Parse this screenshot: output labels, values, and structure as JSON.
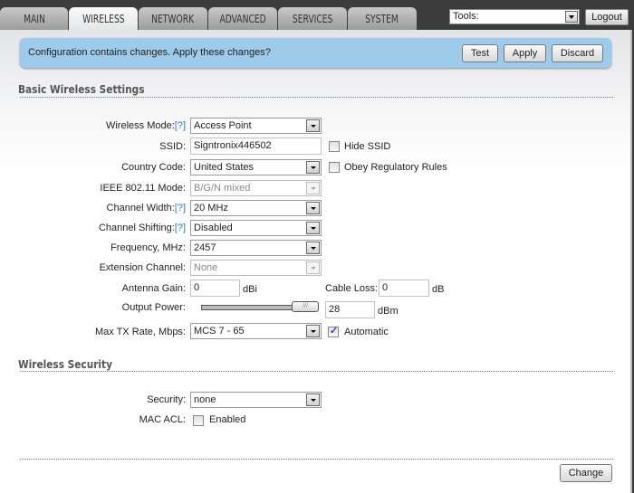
{
  "tabs": [
    {
      "label": "MAIN",
      "active": false
    },
    {
      "label": "WIRELESS",
      "active": true
    },
    {
      "label": "NETWORK",
      "active": false
    },
    {
      "label": "ADVANCED",
      "active": false
    },
    {
      "label": "SERVICES",
      "active": false
    },
    {
      "label": "SYSTEM",
      "active": false
    }
  ],
  "header": {
    "tools_value": "Tools:",
    "logout_label": "Logout"
  },
  "notice": {
    "message": "Configuration contains changes. Apply these changes?",
    "test_label": "Test",
    "apply_label": "Apply",
    "discard_label": "Discard"
  },
  "basic": {
    "title": "Basic Wireless Settings",
    "help": "[?]",
    "wireless_mode": {
      "label": "Wireless Mode:",
      "value": "Access Point"
    },
    "ssid": {
      "label": "SSID:",
      "value": "Signtronix446502",
      "hide_label": "Hide SSID",
      "hide_checked": false
    },
    "country": {
      "label": "Country Code:",
      "value": "United States",
      "obey_label": "Obey Regulatory Rules",
      "obey_checked": false
    },
    "ieee_mode": {
      "label": "IEEE 802.11 Mode:",
      "value": "B/G/N mixed",
      "disabled": true
    },
    "channel_width": {
      "label": "Channel Width:",
      "value": "20 MHz"
    },
    "channel_shifting": {
      "label": "Channel Shifting:",
      "value": "Disabled"
    },
    "frequency": {
      "label": "Frequency, MHz:",
      "value": "2457"
    },
    "extension_channel": {
      "label": "Extension Channel:",
      "value": "None",
      "disabled": true
    },
    "antenna_gain": {
      "label": "Antenna Gain:",
      "value": "0",
      "unit": "dBi"
    },
    "cable_loss": {
      "label": "Cable Loss:",
      "value": "0",
      "unit": "dB"
    },
    "output_power": {
      "label": "Output Power:",
      "value": "28",
      "unit": "dBm",
      "slider_fraction": 1.0,
      "thumb_glyph": "///"
    },
    "max_tx_rate": {
      "label": "Max TX Rate, Mbps:",
      "value": "MCS 7 - 65",
      "auto_label": "Automatic",
      "auto_checked": true
    }
  },
  "security": {
    "title": "Wireless Security",
    "security": {
      "label": "Security:",
      "value": "none"
    },
    "mac_acl": {
      "label": "MAC ACL:",
      "enabled_label": "Enabled",
      "checked": false
    }
  },
  "footer": {
    "change_label": "Change"
  }
}
